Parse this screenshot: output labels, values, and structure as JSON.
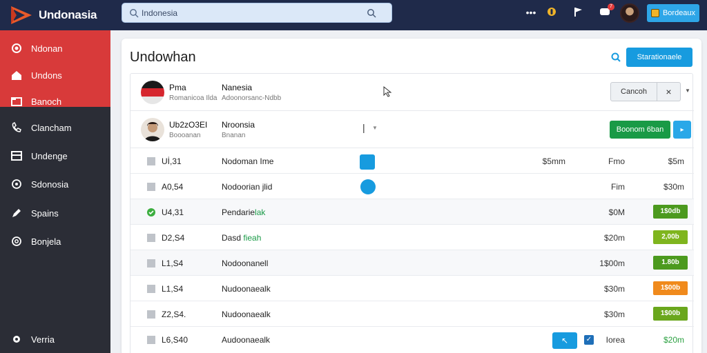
{
  "app": {
    "name": "Undonasia",
    "accent": "#d83a3a"
  },
  "search": {
    "value": "Indonesia",
    "placeholder": "Indonesia"
  },
  "topbar": {
    "icons": [
      "more-icon",
      "notification-icon",
      "flag-icon",
      "messages-icon"
    ],
    "message_badge": "7",
    "button_label": "Bordeaux"
  },
  "sidebar": {
    "items": [
      {
        "label": "Ndonan",
        "icon": "circle-icon"
      },
      {
        "label": "Undons",
        "icon": "home-icon"
      },
      {
        "label": "Banoch",
        "icon": "folder-icon"
      },
      {
        "label": "Clancham",
        "icon": "phone-icon"
      },
      {
        "label": "Undenge",
        "icon": "table-icon"
      },
      {
        "label": "Sdonosia",
        "icon": "globe-icon"
      },
      {
        "label": "Spains",
        "icon": "edit-icon"
      },
      {
        "label": "Bonjela",
        "icon": "settings-icon"
      }
    ],
    "footer": {
      "label": "Verria",
      "icon": "gear-icon"
    }
  },
  "main": {
    "title": "Undowhan",
    "primary_button": "Starationaele",
    "people": [
      {
        "name": "Pma",
        "sub": "Romanicoa Ilda",
        "col": "Nanesia",
        "colsub": "Adoonorsanc-Ndbb",
        "actions": [
          "Cancoh",
          "×"
        ]
      },
      {
        "name": "Ub2zO3EI",
        "sub": "Boooanan",
        "col": "Nroonsia",
        "colsub": "Bnanan",
        "actions": [
          "Boonom 6ban"
        ]
      }
    ],
    "rows": [
      {
        "code": "Uİ,31",
        "name": "Nodoman",
        "name_hl": "Ime",
        "amt1": "$5mm",
        "amt2": "Fmo",
        "amt3": "$5m",
        "tag": "",
        "tag_color": "",
        "icon": "file-icon"
      },
      {
        "code": "A0,54",
        "name": "Nodoorian",
        "name_hl": "jlid",
        "amt1": "",
        "amt2": "Fim",
        "amt3": "$30m",
        "tag": "",
        "tag_color": "",
        "icon": "file-icon"
      },
      {
        "code": "U4,31",
        "name": "Pendarie",
        "name_hl": "lak",
        "amt1": "",
        "amt2": "$0M",
        "amt3": "",
        "tag": "1$0db",
        "tag_color": "#4c9a1e",
        "icon": "check-icon"
      },
      {
        "code": "D2,S4",
        "name": "Dasd ",
        "name_hl": "fieah",
        "amt1": "",
        "amt2": "$20m",
        "amt3": "",
        "tag": "2,00b",
        "tag_color": "#7fb51e",
        "icon": "file-icon"
      },
      {
        "code": "L1,S4",
        "name": "Nodoonanell",
        "name_hl": "",
        "amt1": "",
        "amt2": "1$00m",
        "amt3": "",
        "tag": "1.80b",
        "tag_color": "#4c9a1e",
        "icon": "file-icon"
      },
      {
        "code": "L1,S4",
        "name": "Nudoonaealk",
        "name_hl": "",
        "amt1": "",
        "amt2": "$30m",
        "amt3": "",
        "tag": "1$00b",
        "tag_color": "#f08a1c",
        "icon": "file-icon"
      },
      {
        "code": "Z2,S4.",
        "name": "Nudoonaealk",
        "name_hl": "",
        "amt1": "",
        "amt2": "$30m",
        "amt3": "",
        "tag": "1$00b",
        "tag_color": "#6aa71d",
        "icon": "file-icon"
      },
      {
        "code": "L6,S40",
        "name": "Audoonaealk",
        "name_hl": "",
        "amt1": "",
        "amt2": "Iorea",
        "amt3": "$20m",
        "tag": "",
        "tag_color": "",
        "icon": "file-icon"
      }
    ]
  }
}
